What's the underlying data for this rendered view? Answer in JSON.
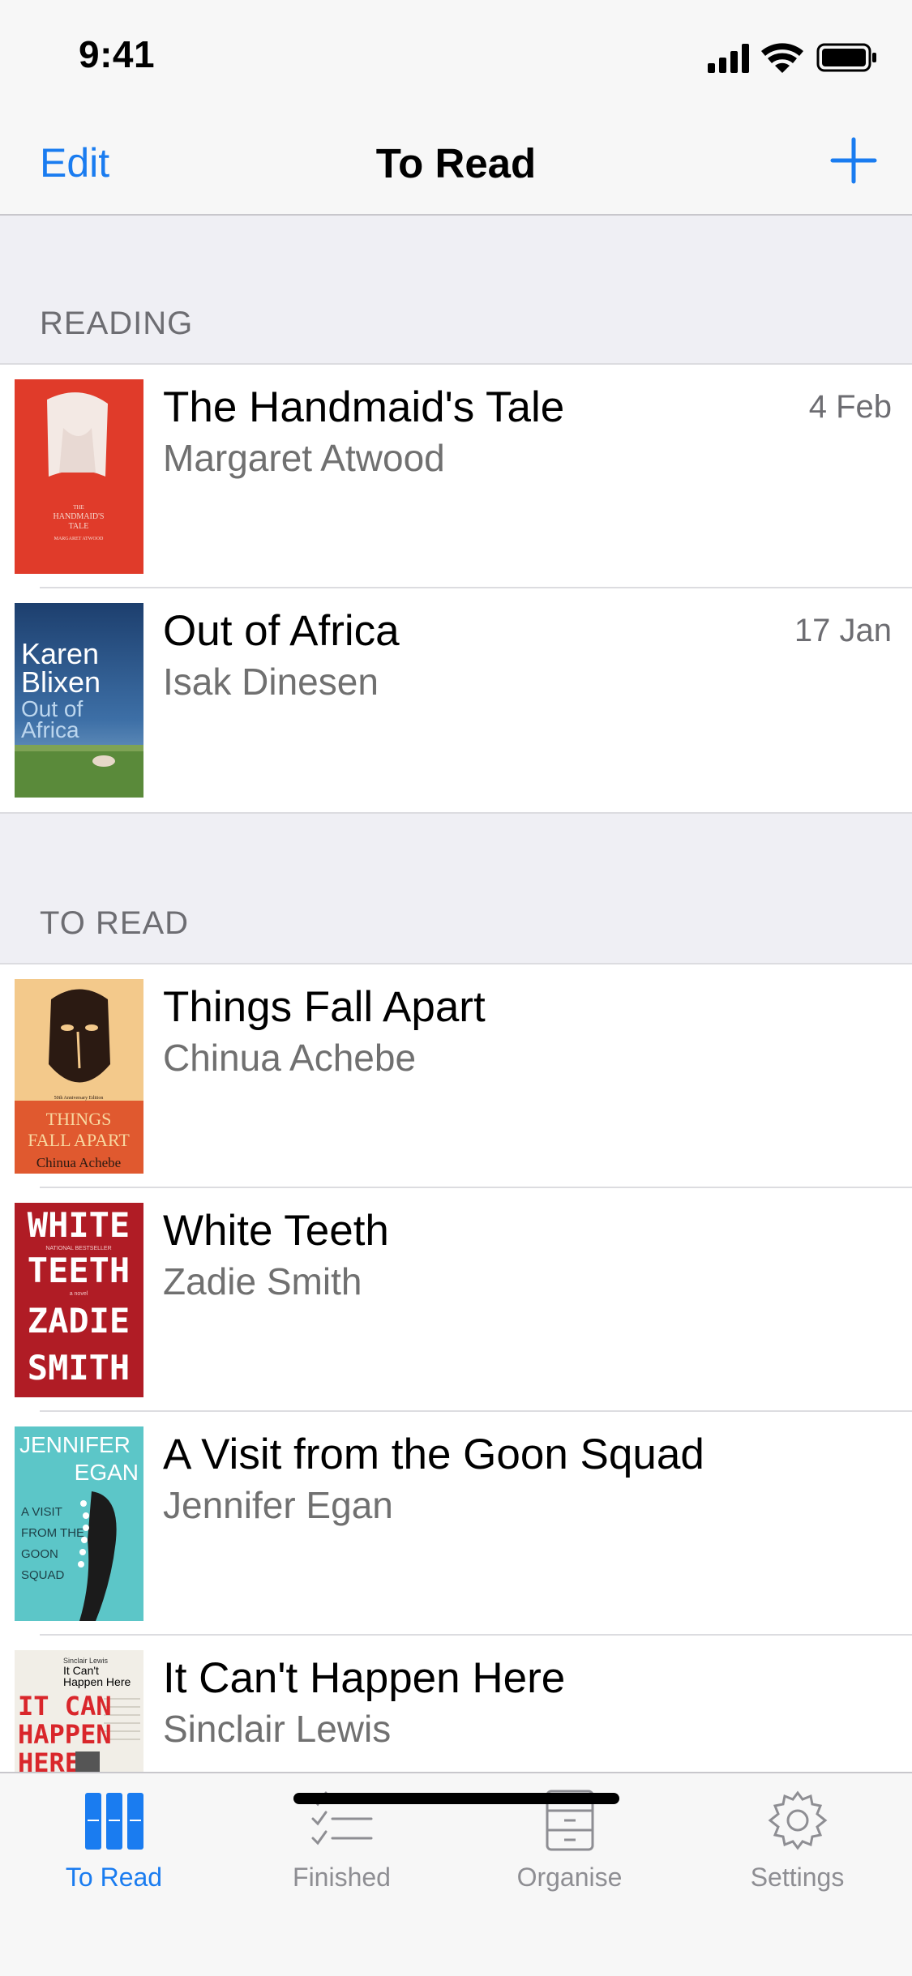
{
  "status_bar": {
    "time": "9:41"
  },
  "nav": {
    "edit_label": "Edit",
    "title": "To Read",
    "add_icon": "plus-icon"
  },
  "sections": [
    {
      "header": "READING",
      "books": [
        {
          "title": "The Handmaid's Tale",
          "author": "Margaret Atwood",
          "date": "4 Feb",
          "cover_text": [
            "THE",
            "HANDMAID'S",
            "TALE",
            "MARGARET ATWOOD"
          ]
        },
        {
          "title": "Out of Africa",
          "author": "Isak Dinesen",
          "date": "17 Jan",
          "cover_text": [
            "Karen",
            "Blixen",
            "Out of",
            "Africa"
          ]
        }
      ]
    },
    {
      "header": "TO READ",
      "books": [
        {
          "title": "Things Fall Apart",
          "author": "Chinua Achebe",
          "cover_text": [
            "50th Anniversary Edition",
            "THINGS",
            "FALL APART",
            "Chinua Achebe"
          ]
        },
        {
          "title": "White Teeth",
          "author": "Zadie Smith",
          "cover_text": [
            "WHITE",
            "NATIONAL BESTSELLER",
            "TEETH",
            "a novel",
            "ZADIE",
            "SMITH"
          ]
        },
        {
          "title": "A Visit from the Goon Squad",
          "author": "Jennifer Egan",
          "cover_text": [
            "JENNIFER",
            "EGAN",
            "A VISIT",
            "FROM THE",
            "GOON",
            "SQUAD"
          ]
        },
        {
          "title": "It Can't Happen Here",
          "author": "Sinclair Lewis",
          "cover_text": [
            "Sinclair Lewis",
            "It Can't",
            "Happen Here",
            "IT CAN",
            "HAPPEN",
            "HERE"
          ]
        }
      ]
    }
  ],
  "tabs": [
    {
      "label": "To Read",
      "icon": "books-icon",
      "active": true
    },
    {
      "label": "Finished",
      "icon": "checklist-icon",
      "active": false
    },
    {
      "label": "Organise",
      "icon": "cabinet-icon",
      "active": false
    },
    {
      "label": "Settings",
      "icon": "gear-icon",
      "active": false
    }
  ],
  "colors": {
    "accent": "#1a7cf0",
    "inactive": "#8e8e93"
  }
}
